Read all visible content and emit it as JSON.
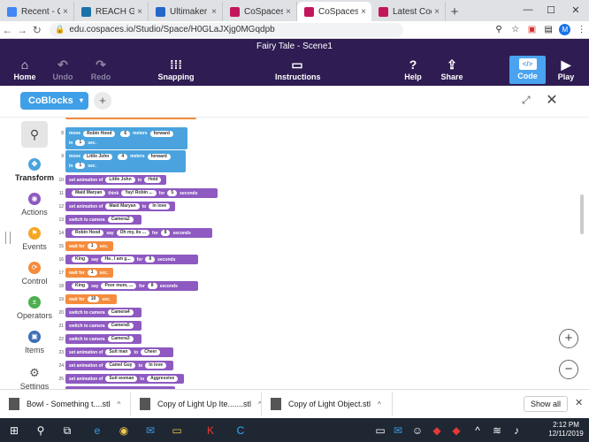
{
  "browser": {
    "tabs": [
      {
        "title": "Recent - Go",
        "color": "#4285f4",
        "active": false
      },
      {
        "title": "REACH Grad",
        "color": "#1a73a8",
        "active": false
      },
      {
        "title": "Ultimaker Cu",
        "color": "#2467c9",
        "active": false
      },
      {
        "title": "CoSpaces Ed",
        "color": "#c2185b",
        "active": false
      },
      {
        "title": "CoSpaces Ed",
        "color": "#c2185b",
        "active": true
      },
      {
        "title": "Latest Codin",
        "color": "#c2185b",
        "active": false
      }
    ],
    "url": "edu.cospaces.io/Studio/Space/H0GLaJXjg0MGqdpb",
    "profile": "M"
  },
  "app": {
    "title": "Fairy Tale - Scene1",
    "buttons": {
      "home": "Home",
      "undo": "Undo",
      "redo": "Redo",
      "snapping": "Snapping",
      "instructions": "Instructions",
      "help": "Help",
      "share": "Share",
      "code": "Code",
      "play": "Play"
    }
  },
  "coblocks": {
    "label": "CoBlocks"
  },
  "sidebar": {
    "categories": [
      {
        "label": "Transform",
        "color": "#4aa3de",
        "icon": "transform-icon"
      },
      {
        "label": "Actions",
        "color": "#8e59c1",
        "icon": "actions-icon"
      },
      {
        "label": "Events",
        "color": "#f5a623",
        "icon": "events-icon"
      },
      {
        "label": "Control",
        "color": "#f58b3c",
        "icon": "control-icon"
      },
      {
        "label": "Operators",
        "color": "#4caf50",
        "icon": "operators-icon"
      },
      {
        "label": "Items",
        "color": "#3b6fb6",
        "icon": "items-icon"
      },
      {
        "label": "Settings",
        "color": "#555555",
        "icon": "gear-icon"
      }
    ]
  },
  "code": {
    "line8": {
      "num": "8",
      "a": "move",
      "b": "Robin Hood",
      "c": "6",
      "d": "meters",
      "e": "forward",
      "f": "in",
      "g": "1",
      "h": "sec."
    },
    "line9": {
      "num": "9",
      "a": "move",
      "b": "Little John",
      "c": "4",
      "d": "meters",
      "e": "forward",
      "f": "in",
      "g": "1",
      "h": "sec."
    },
    "line10": {
      "num": "10",
      "a": "set animation of",
      "b": "Little John",
      "c": "to",
      "d": "Hold"
    },
    "line11": {
      "num": "11",
      "a": "Maid Maryan",
      "b": "think",
      "c": "Yay! Robin ...",
      "d": "for",
      "e": "5",
      "f": "seconds"
    },
    "line12": {
      "num": "12",
      "a": "set animation of",
      "b": "Maid Maryan",
      "c": "to",
      "d": "In love"
    },
    "line13": {
      "num": "13",
      "a": "switch to camera",
      "b": "Camera2"
    },
    "line14": {
      "num": "14",
      "a": "Robin Hood",
      "b": "say",
      "c": "Oh my, its ...",
      "d": "for",
      "e": "8",
      "f": "seconds"
    },
    "line15": {
      "num": "15",
      "a": "wait for",
      "b": "1",
      "c": "sec."
    },
    "line16": {
      "num": "16",
      "a": "King",
      "b": "say",
      "c": "Ha , I am g...",
      "d": "for",
      "e": "8",
      "f": "seconds"
    },
    "line17": {
      "num": "17",
      "a": "wait for",
      "b": "1",
      "c": "sec."
    },
    "line18": {
      "num": "18",
      "a": "King",
      "b": "say",
      "c": "Poor mum, ...",
      "d": "for",
      "e": "8",
      "f": "seconds"
    },
    "line19": {
      "num": "19",
      "a": "wait for",
      "b": "10",
      "c": "sec."
    },
    "line20": {
      "num": "20",
      "a": "switch to camera",
      "b": "Camera4"
    },
    "line21": {
      "num": "21",
      "a": "switch to camera",
      "b": "Camera5"
    },
    "line22": {
      "num": "22",
      "a": "switch to camera",
      "b": "Camera3"
    },
    "line23": {
      "num": "23",
      "a": "set animation of",
      "b": "Suit man",
      "c": "to",
      "d": "Cheer"
    },
    "line24": {
      "num": "24",
      "a": "set animation of",
      "b": "Camel Guy",
      "c": "to",
      "d": "In love"
    },
    "line25": {
      "num": "25",
      "a": "set animation of",
      "b": "Suit woman",
      "c": "to",
      "d": "Aggressive"
    }
  },
  "downloads": [
    {
      "name": "Bowl - Something t....stl"
    },
    {
      "name": "Copy of Light Up Ite.......stl"
    },
    {
      "name": "Copy of Light Object.stl"
    }
  ],
  "download_actions": {
    "show_all": "Show all"
  },
  "taskbar": {
    "time": "2:12 PM",
    "date": "12/11/2019"
  }
}
